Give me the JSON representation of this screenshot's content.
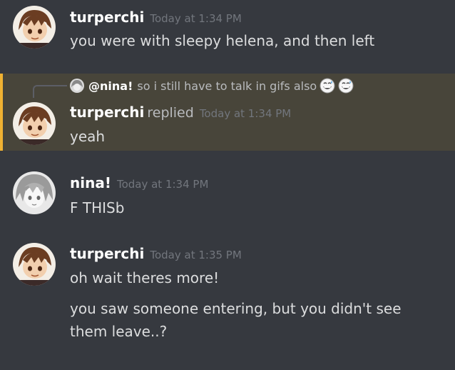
{
  "messages": [
    {
      "username": "turperchi",
      "timestamp": "Today at 1:34 PM",
      "lines": [
        "you were with sleepy helena, and then left"
      ]
    },
    {
      "reply_to": {
        "author": "@nina!",
        "text": "so i still have to talk in gifs also",
        "emojis": [
          "grinning-sweat-emoji",
          "grinning-sweat-emoji"
        ]
      },
      "username": "turperchi",
      "replied_label": "replied",
      "timestamp": "Today at 1:34 PM",
      "lines": [
        "yeah"
      ]
    },
    {
      "username": "nina!",
      "timestamp": "Today at 1:34 PM",
      "lines": [
        "F THISb"
      ]
    },
    {
      "username": "turperchi",
      "timestamp": "Today at 1:35 PM",
      "lines": [
        "oh wait theres more!",
        "you saw someone entering, but you didn't see",
        "them leave..?"
      ]
    }
  ],
  "colors": {
    "background": "#36393f",
    "highlight": "#48453a",
    "highlight_border": "#f0b232",
    "username": "#ffffff",
    "timestamp": "#72767d",
    "text": "#dcddde"
  }
}
